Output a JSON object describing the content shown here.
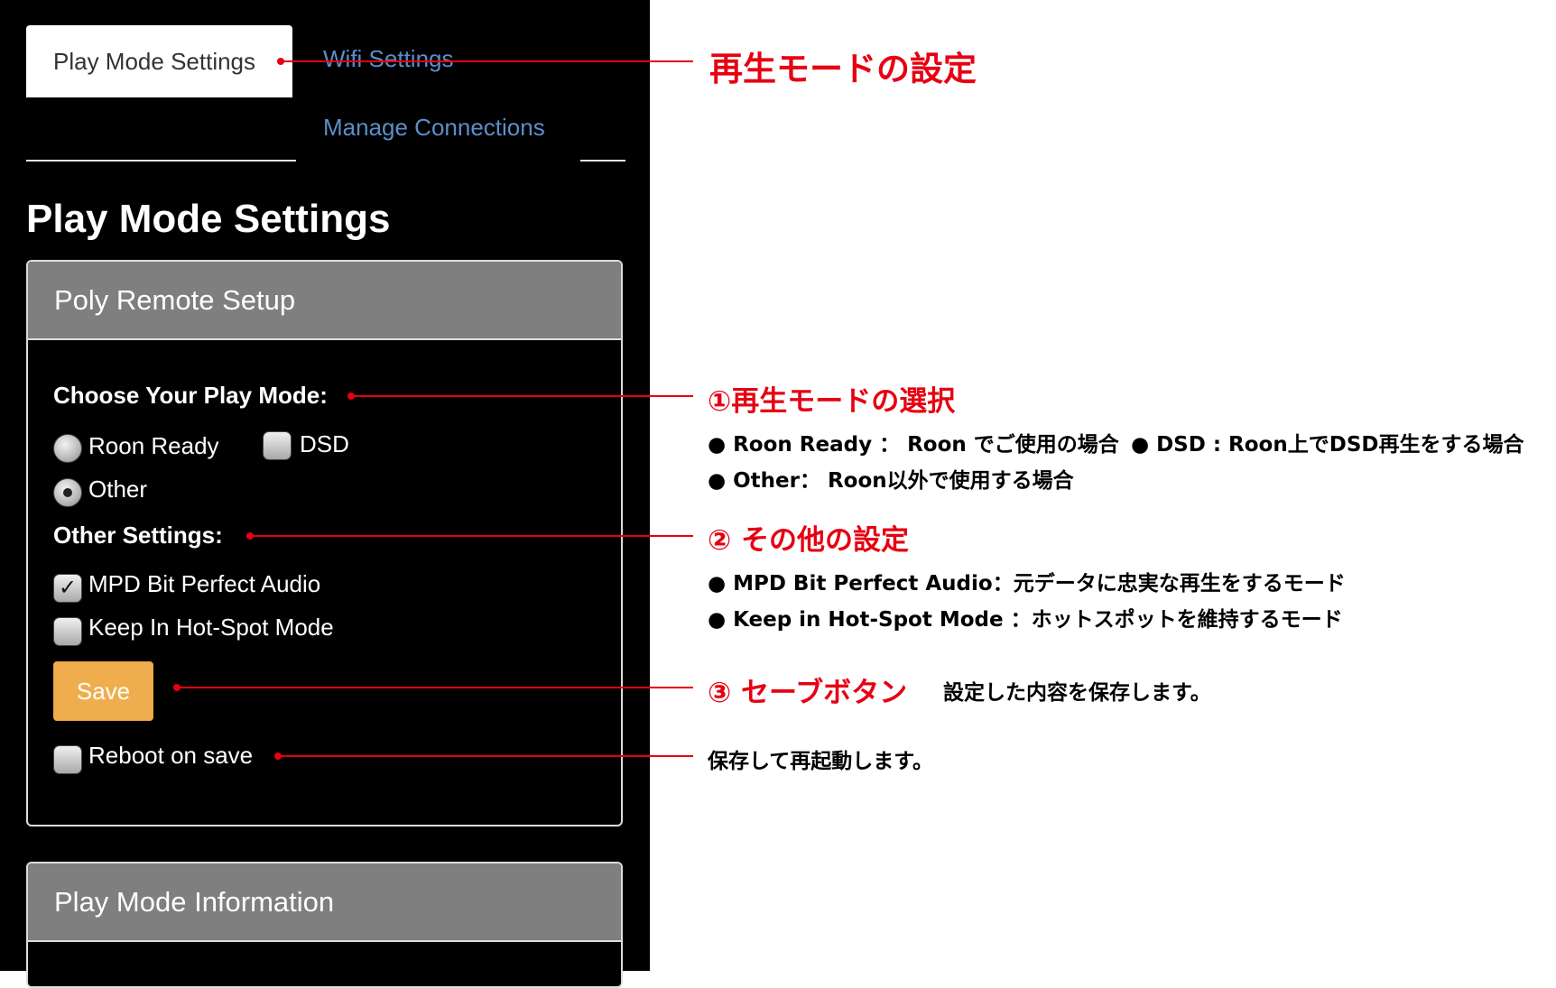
{
  "tabs": {
    "active": "Play Mode Settings",
    "wifi": "Wifi Settings",
    "manage": "Manage Connections"
  },
  "page_title": "Play Mode Settings",
  "setup_panel": {
    "header": "Poly Remote Setup",
    "play_mode_label": "Choose Your Play Mode:",
    "play_modes": {
      "roon_ready": {
        "label": "Roon Ready",
        "selected": false
      },
      "dsd": {
        "label": "DSD",
        "checked": false
      },
      "other": {
        "label": "Other",
        "selected": true
      }
    },
    "other_settings_label": "Other Settings:",
    "other_settings": {
      "mpd": {
        "label": "MPD Bit Perfect Audio",
        "checked": true
      },
      "hotspot": {
        "label": "Keep In Hot-Spot Mode",
        "checked": false
      }
    },
    "save_label": "Save",
    "reboot": {
      "label": "Reboot on save",
      "checked": false
    }
  },
  "info_panel": {
    "header": "Play Mode Information"
  },
  "annotations": {
    "tabs_title": "再生モードの設定",
    "play_mode_title": "①再生モードの選択",
    "play_mode_notes": {
      "roon_ready": "● Roon Ready ： Roon でご使用の場合",
      "dsd": "● DSD : Roon上でDSD再生をする場合",
      "other": "● Other： Roon以外で使用する場合"
    },
    "other_title": "② その他の設定",
    "other_notes": {
      "mpd": "● MPD Bit Perfect Audio：元データに忠実な再生をするモード",
      "hotspot": "● Keep in Hot-Spot Mode ：ホットスポットを維持するモード"
    },
    "save_title": "③ セーブボタン",
    "save_note": "設定した内容を保存します。",
    "reboot_note": "保存して再起動します。"
  },
  "colors": {
    "app_background": "#000000",
    "panel_header": "#7f7f7f",
    "link": "#5b8ec9",
    "save_button": "#f0ad4e",
    "annotation_red": "#e60012"
  }
}
